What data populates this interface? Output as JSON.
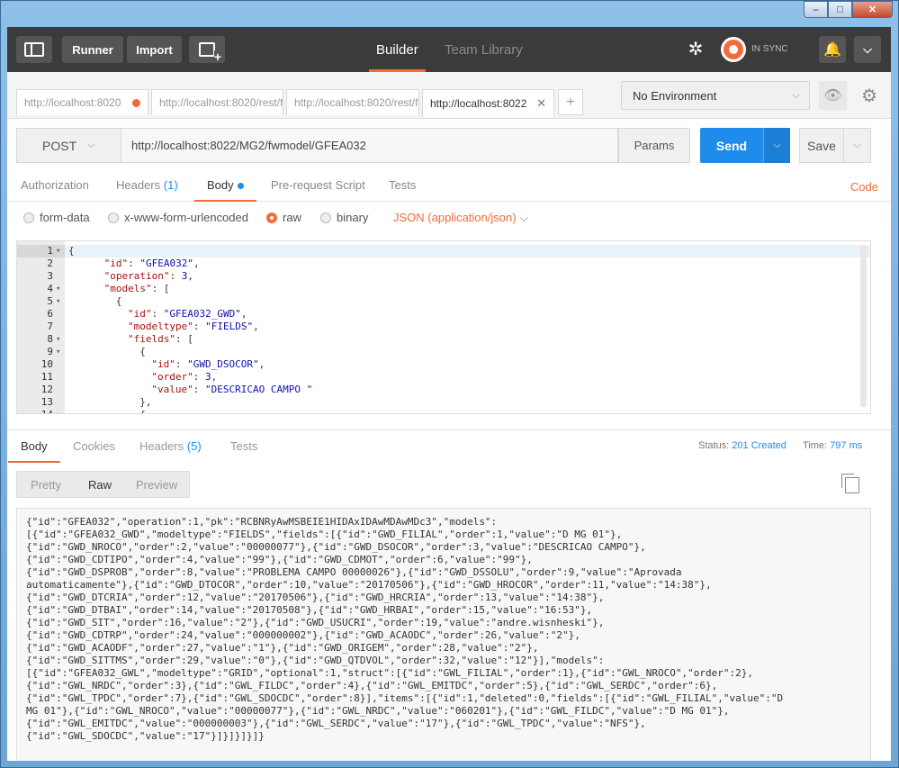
{
  "window": {
    "buttons": [
      "–",
      "□",
      "✕"
    ]
  },
  "header": {
    "runner_label": "Runner",
    "import_label": "Import",
    "builder_label": "Builder",
    "team_library_label": "Team Library",
    "sync_status": "IN SYNC"
  },
  "tabs": [
    {
      "label": "http://localhost:8020"
    },
    {
      "label": "http://localhost:8020/rest/f"
    },
    {
      "label": "http://localhost:8020/rest/f"
    },
    {
      "label": "http://localhost:8022"
    }
  ],
  "environment": {
    "selected": "No Environment"
  },
  "request": {
    "method": "POST",
    "url": "http://localhost:8022/MG2/fwmodel/GFEA032",
    "params_label": "Params",
    "send_label": "Send",
    "save_label": "Save"
  },
  "subtabs": {
    "authorization": "Authorization",
    "headers": "Headers",
    "headers_count": "(1)",
    "body": "Body",
    "prerequest": "Pre-request Script",
    "tests": "Tests",
    "code": "Code"
  },
  "body_types": {
    "form_data": "form-data",
    "urlencoded": "x-www-form-urlencoded",
    "raw": "raw",
    "binary": "binary",
    "content_type": "JSON (application/json)"
  },
  "editor_lines": [
    {
      "n": "1",
      "fold": true,
      "indent": 0,
      "parts": [
        [
          "p",
          "{"
        ]
      ]
    },
    {
      "n": "2",
      "fold": false,
      "indent": 6,
      "parts": [
        [
          "k",
          "\"id\""
        ],
        [
          "p",
          ": "
        ],
        [
          "s",
          "\"GFEA032\""
        ],
        [
          "p",
          ","
        ]
      ]
    },
    {
      "n": "3",
      "fold": false,
      "indent": 6,
      "parts": [
        [
          "k",
          "\"operation\""
        ],
        [
          "p",
          ": "
        ],
        [
          "n",
          "3"
        ],
        [
          "p",
          ","
        ]
      ]
    },
    {
      "n": "4",
      "fold": true,
      "indent": 6,
      "parts": [
        [
          "k",
          "\"models\""
        ],
        [
          "p",
          ": ["
        ]
      ]
    },
    {
      "n": "5",
      "fold": true,
      "indent": 8,
      "parts": [
        [
          "p",
          "{"
        ]
      ]
    },
    {
      "n": "6",
      "fold": false,
      "indent": 10,
      "parts": [
        [
          "k",
          "\"id\""
        ],
        [
          "p",
          ": "
        ],
        [
          "s",
          "\"GFEA032_GWD\""
        ],
        [
          "p",
          ","
        ]
      ]
    },
    {
      "n": "7",
      "fold": false,
      "indent": 10,
      "parts": [
        [
          "k",
          "\"modeltype\""
        ],
        [
          "p",
          ": "
        ],
        [
          "s",
          "\"FIELDS\""
        ],
        [
          "p",
          ","
        ]
      ]
    },
    {
      "n": "8",
      "fold": true,
      "indent": 10,
      "parts": [
        [
          "k",
          "\"fields\""
        ],
        [
          "p",
          ": ["
        ]
      ]
    },
    {
      "n": "9",
      "fold": true,
      "indent": 12,
      "parts": [
        [
          "p",
          "{"
        ]
      ]
    },
    {
      "n": "10",
      "fold": false,
      "indent": 14,
      "parts": [
        [
          "k",
          "\"id\""
        ],
        [
          "p",
          ": "
        ],
        [
          "s",
          "\"GWD_DSOCOR\""
        ],
        [
          "p",
          ","
        ]
      ]
    },
    {
      "n": "11",
      "fold": false,
      "indent": 14,
      "parts": [
        [
          "k",
          "\"order\""
        ],
        [
          "p",
          ": "
        ],
        [
          "n",
          "3"
        ],
        [
          "p",
          ","
        ]
      ]
    },
    {
      "n": "12",
      "fold": false,
      "indent": 14,
      "parts": [
        [
          "k",
          "\"value\""
        ],
        [
          "p",
          ": "
        ],
        [
          "s",
          "\"DESCRICAO CAMPO \""
        ]
      ]
    },
    {
      "n": "13",
      "fold": false,
      "indent": 12,
      "parts": [
        [
          "p",
          "},"
        ]
      ]
    },
    {
      "n": "14",
      "fold": true,
      "indent": 12,
      "parts": [
        [
          "p",
          "{"
        ]
      ]
    }
  ],
  "response": {
    "body_label": "Body",
    "cookies_label": "Cookies",
    "headers_label": "Headers",
    "headers_count": "(5)",
    "tests_label": "Tests",
    "status_label": "Status:",
    "status_value": "201 Created",
    "time_label": "Time:",
    "time_value": "797 ms",
    "view_pretty": "Pretty",
    "view_raw": "Raw",
    "view_preview": "Preview",
    "raw_body": "{\"id\":\"GFEA032\",\"operation\":1,\"pk\":\"RCBNRyAwMSBEIE1HIDAxIDAwMDAwMDc3\",\"models\":\n[{\"id\":\"GFEA032_GWD\",\"modeltype\":\"FIELDS\",\"fields\":[{\"id\":\"GWD_FILIAL\",\"order\":1,\"value\":\"D MG 01\"},\n{\"id\":\"GWD_NROCO\",\"order\":2,\"value\":\"00000077\"},{\"id\":\"GWD_DSOCOR\",\"order\":3,\"value\":\"DESCRICAO CAMPO\"},\n{\"id\":\"GWD_CDTIPO\",\"order\":4,\"value\":\"99\"},{\"id\":\"GWD_CDMOT\",\"order\":6,\"value\":\"99\"},\n{\"id\":\"GWD_DSPROB\",\"order\":8,\"value\":\"PROBLEMA CAMPO 00000026\"},{\"id\":\"GWD_DSSOLU\",\"order\":9,\"value\":\"Aprovada\nautomaticamente\"},{\"id\":\"GWD_DTOCOR\",\"order\":10,\"value\":\"20170506\"},{\"id\":\"GWD_HROCOR\",\"order\":11,\"value\":\"14:38\"},\n{\"id\":\"GWD_DTCRIA\",\"order\":12,\"value\":\"20170506\"},{\"id\":\"GWD_HRCRIA\",\"order\":13,\"value\":\"14:38\"},\n{\"id\":\"GWD_DTBAI\",\"order\":14,\"value\":\"20170508\"},{\"id\":\"GWD_HRBAI\",\"order\":15,\"value\":\"16:53\"},\n{\"id\":\"GWD_SIT\",\"order\":16,\"value\":\"2\"},{\"id\":\"GWD_USUCRI\",\"order\":19,\"value\":\"andre.wisnheski\"},\n{\"id\":\"GWD_CDTRP\",\"order\":24,\"value\":\"000000002\"},{\"id\":\"GWD_ACAODC\",\"order\":26,\"value\":\"2\"},\n{\"id\":\"GWD_ACAODF\",\"order\":27,\"value\":\"1\"},{\"id\":\"GWD_ORIGEM\",\"order\":28,\"value\":\"2\"},\n{\"id\":\"GWD_SITTMS\",\"order\":29,\"value\":\"0\"},{\"id\":\"GWD_QTDVOL\",\"order\":32,\"value\":\"12\"}],\"models\":\n[{\"id\":\"GFEA032_GWL\",\"modeltype\":\"GRID\",\"optional\":1,\"struct\":[{\"id\":\"GWL_FILIAL\",\"order\":1},{\"id\":\"GWL_NROCO\",\"order\":2},\n{\"id\":\"GWL_NRDC\",\"order\":3},{\"id\":\"GWL_FILDC\",\"order\":4},{\"id\":\"GWL_EMITDC\",\"order\":5},{\"id\":\"GWL_SERDC\",\"order\":6},\n{\"id\":\"GWL_TPDC\",\"order\":7},{\"id\":\"GWL_SDOCDC\",\"order\":8}],\"items\":[{\"id\":1,\"deleted\":0,\"fields\":[{\"id\":\"GWL_FILIAL\",\"value\":\"D\nMG 01\"},{\"id\":\"GWL_NROCO\",\"value\":\"00000077\"},{\"id\":\"GWL_NRDC\",\"value\":\"060201\"},{\"id\":\"GWL_FILDC\",\"value\":\"D MG 01\"},\n{\"id\":\"GWL_EMITDC\",\"value\":\"000000003\"},{\"id\":\"GWL_SERDC\",\"value\":\"17\"},{\"id\":\"GWL_TPDC\",\"value\":\"NFS\"},\n{\"id\":\"GWL_SDOCDC\",\"value\":\"17\"}]}]}]}]}"
  },
  "colors": {
    "accent": "#f26b3a",
    "primary": "#1f8ceb",
    "header_bg": "#3b3b3b"
  }
}
